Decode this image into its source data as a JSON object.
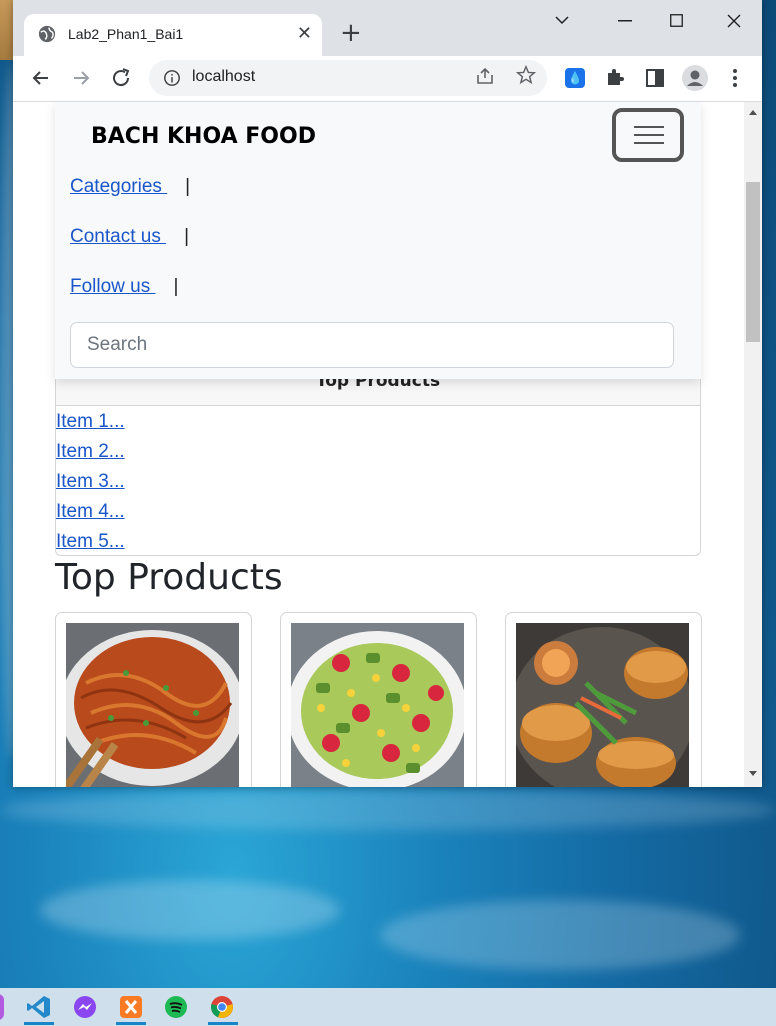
{
  "browser": {
    "tab_title": "Lab2_Phan1_Bai1",
    "tab_close": "✕",
    "new_tab": "+",
    "url": "localhost",
    "icons": [
      "globe-icon",
      "back-icon",
      "forward-icon",
      "reload-icon",
      "info-icon",
      "share-icon",
      "star-icon",
      "extension-icon",
      "puzzle-icon",
      "sidepanel-icon",
      "profile-icon",
      "menu-icon"
    ]
  },
  "navbar": {
    "brand": "BACH KHOA FOOD",
    "links": [
      {
        "label": "Categories ",
        "sep": "|"
      },
      {
        "label": "Contact us ",
        "sep": "|"
      },
      {
        "label": "Follow us ",
        "sep": "|"
      }
    ],
    "search_placeholder": "Search"
  },
  "sidebar": {
    "title": "Top Products",
    "items": [
      "Item 1...",
      "Item 2...",
      "Item 3...",
      "Item 4...",
      "Item 5..."
    ]
  },
  "main": {
    "section_title": "Top Products",
    "products": [
      {
        "image": "noodles"
      },
      {
        "image": "salad"
      },
      {
        "image": "banh-mi"
      }
    ]
  },
  "taskbar": {
    "apps": [
      "vscode-icon",
      "messenger-icon",
      "xampp-icon",
      "spotify-icon",
      "chrome-icon"
    ]
  }
}
